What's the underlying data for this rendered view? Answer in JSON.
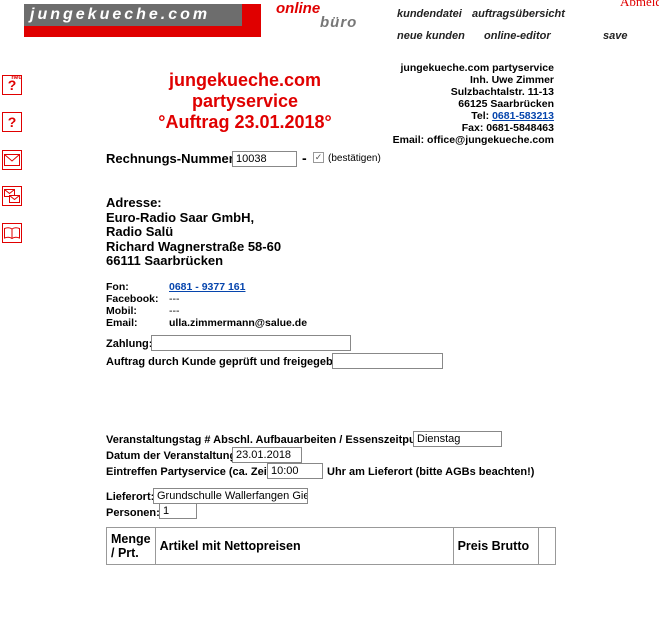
{
  "header": {
    "logo_text": "jungekueche.com",
    "online_label": "online",
    "buero_label": "büro",
    "nav": {
      "kundendatei": "kundendatei",
      "auftragsuebersicht": "auftragsübersicht",
      "neue_kunden": "neue kunden",
      "online_editor": "online-editor",
      "save": "save"
    },
    "abmelden": "Abmelden"
  },
  "sidebar": {
    "icons": [
      "new-help-icon",
      "help-icon",
      "mail-icon",
      "mail-multiple-icon",
      "book-icon"
    ],
    "neu_badge": "neu",
    "question_mark": "?"
  },
  "title": {
    "line1": "jungekueche.com",
    "line2": "partyservice",
    "line3": "°Auftrag 23.01.2018°"
  },
  "company": {
    "name": "jungekueche.com partyservice",
    "owner": "Inh. Uwe Zimmer",
    "street": "Sulzbachtalstr. 11-13",
    "city": "66125 Saarbrücken",
    "tel_label": "Tel:",
    "tel_value": "0681-583213",
    "fax": "Fax: 0681-5848463",
    "email": "Email: office@jungekueche.com"
  },
  "invoice": {
    "label": "Rechnungs-Nummer:",
    "value": "10038",
    "dash": "-",
    "confirm_label": "(bestätigen)",
    "confirmed": true
  },
  "address": {
    "heading": "Adresse:",
    "line1": "Euro-Radio Saar GmbH,",
    "line2": "Radio Salü",
    "line3": "Richard Wagnerstraße 58-60",
    "line4": "66111 Saarbrücken"
  },
  "contact": {
    "fon_label": "Fon:",
    "fon_value": "0681 - 9377 161",
    "facebook_label": "Facebook:",
    "facebook_value": "---",
    "mobil_label": "Mobil:",
    "mobil_value": "---",
    "email_label": "Email:",
    "email_value": "ulla.zimmermann@salue.de"
  },
  "payment": {
    "zahlung_label": "Zahlung:",
    "zahlung_value": "",
    "approved_label": "Auftrag durch Kunde geprüft und freigegeben:",
    "approved_value": ""
  },
  "event": {
    "day_label": "Veranstaltungstag # Abschl. Aufbauarbeiten / Essenszeitpunkt:",
    "day_value": "Dienstag",
    "date_label": "Datum der Veranstaltung:",
    "date_value": "23.01.2018",
    "arrival_label": "Eintreffen Partyservice (ca. Zeit):",
    "arrival_value": "10:00",
    "arrival_note": "Uhr am Lieferort (bitte AGBs beachten!)",
    "lieferort_label": "Lieferort:",
    "lieferort_value": "Grundschulle Wallerfangen Giesing",
    "personen_label": "Personen:",
    "personen_value": "1"
  },
  "table": {
    "col1_line1": "Menge",
    "col1_line2": "/ Prt.",
    "col2": "Artikel mit Nettopreisen",
    "col3": "Preis Brutto"
  },
  "colors": {
    "brand_red": "#e00000",
    "logo_grey": "#6d6d6d",
    "link_blue": "#0645ad"
  }
}
